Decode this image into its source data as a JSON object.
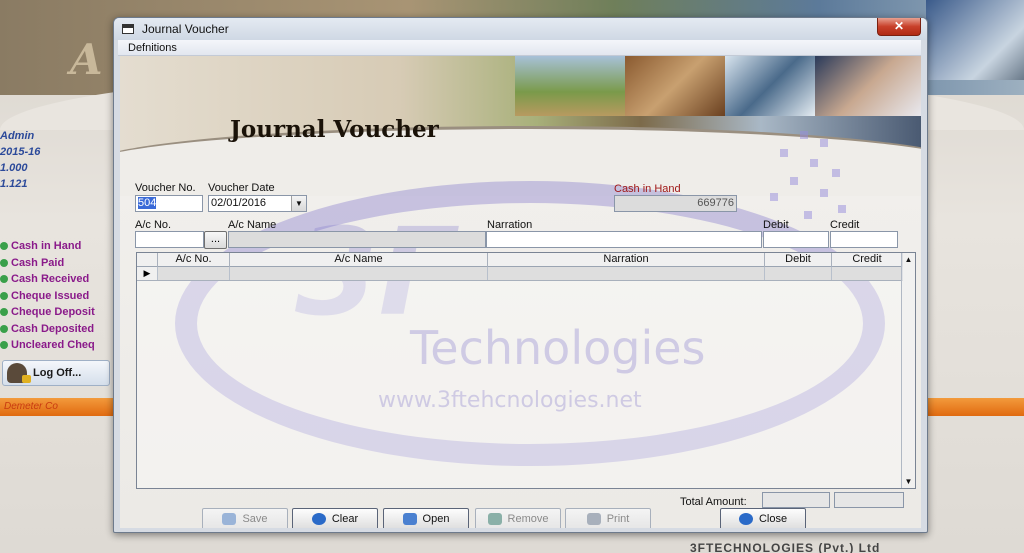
{
  "background_app": {
    "info_lines": [
      "Admin",
      "2015-16",
      "1.000",
      "1.121"
    ],
    "menu_items": [
      "Cash in Hand",
      "Cash Paid",
      "Cash Received",
      "Cheque Issued",
      "Cheque Deposit",
      "Cash Deposited",
      "Uncleared Cheq"
    ],
    "logoff_label": "Log Off...",
    "orange_bar_text": "Demeter Co",
    "footer_text": "3FTECHNOLOGIES (Pvt.) Ltd"
  },
  "window": {
    "title": "Journal Voucher",
    "close_glyph": "✕",
    "menu": [
      "Defnitions"
    ]
  },
  "form": {
    "heading": "Journal Voucher",
    "voucher_no_label": "Voucher No.",
    "voucher_no_value": "504",
    "voucher_date_label": "Voucher Date",
    "voucher_date_value": "02/01/2016",
    "cash_in_hand_label": "Cash in Hand",
    "cash_in_hand_value": "669776",
    "ac_no_label": "A/c No.",
    "ac_name_label": "A/c Name",
    "narration_label": "Narration",
    "debit_label": "Debit",
    "credit_label": "Credit",
    "browse_label": "...",
    "ac_no_value": "",
    "ac_name_value": "",
    "narration_value": "",
    "debit_value": "",
    "credit_value": ""
  },
  "grid": {
    "columns": [
      "A/c No.",
      "A/c Name",
      "Narration",
      "Debit",
      "Credit"
    ],
    "row_indicator": "▶"
  },
  "watermark": {
    "logo": "3F",
    "name": "Technologies",
    "url": "www.3ftehcnologies.net"
  },
  "totals": {
    "label": "Total Amount:",
    "debit_total": "",
    "credit_total": ""
  },
  "buttons": {
    "save": "Save",
    "clear": "Clear",
    "open": "Open",
    "remove": "Remove",
    "print": "Print",
    "close": "Close"
  },
  "colors": {
    "accent_red": "#a01818",
    "watermark": "#786ec8",
    "selection": "#3a6ad8"
  }
}
